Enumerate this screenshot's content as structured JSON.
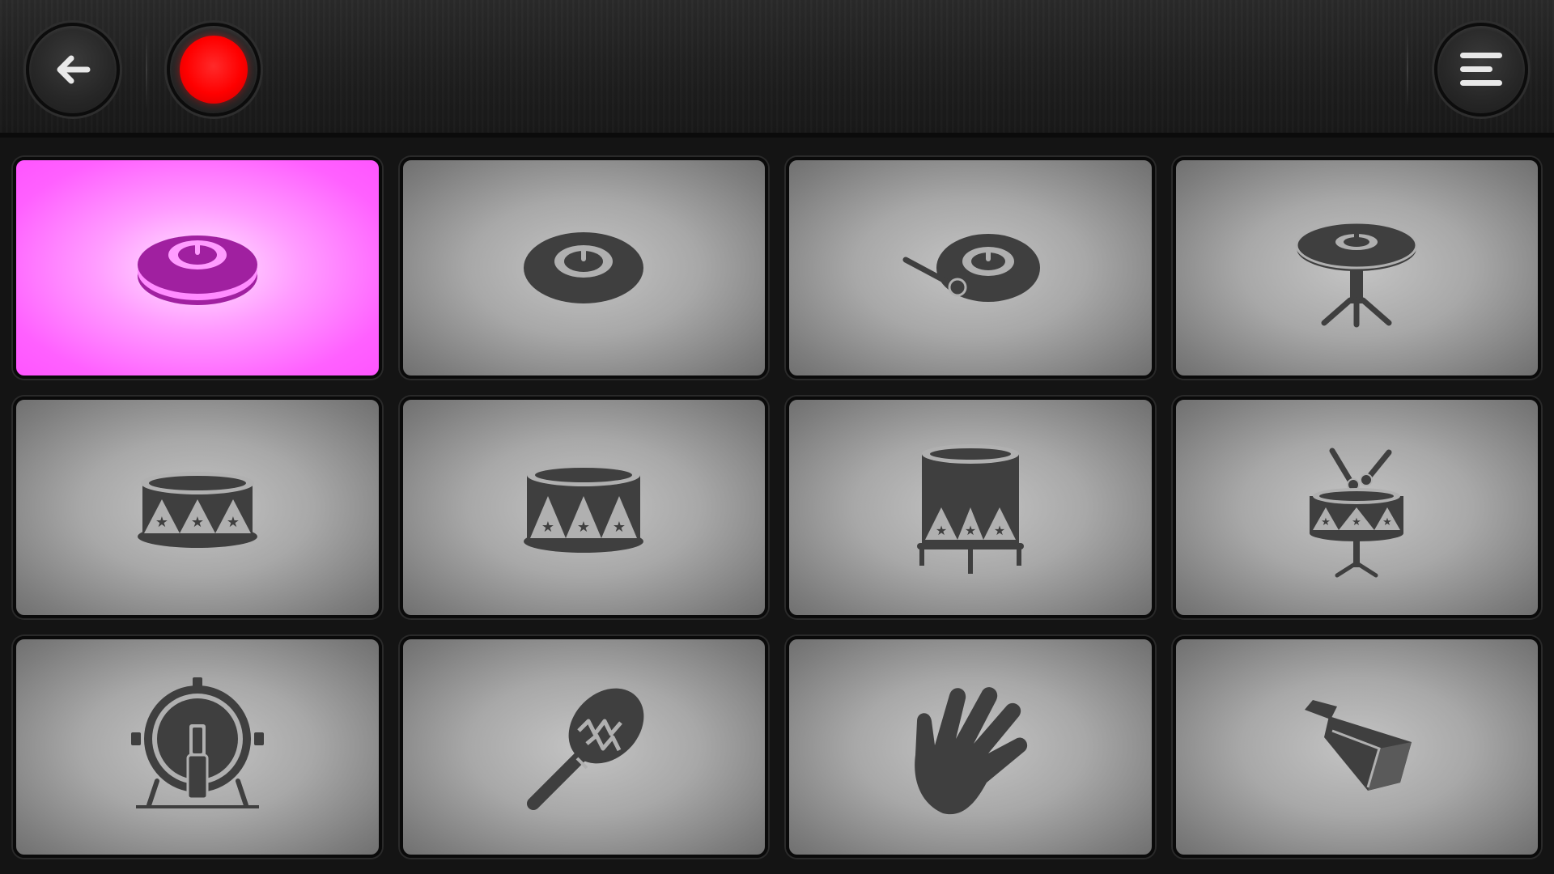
{
  "app": {
    "accent_color": "#ff55ff",
    "record_color": "#ff0000",
    "pad_color": "#a8a8a8",
    "icon_color": "#3f3f3f"
  },
  "topbar": {
    "back_icon": "arrow-left-icon",
    "record_icon": "record-dot-icon",
    "menu_icon": "hamburger-menu-icon"
  },
  "pads": [
    {
      "id": "cymbal-stack",
      "icon": "stacked-cymbal-icon",
      "active": true
    },
    {
      "id": "cymbal",
      "icon": "cymbal-icon",
      "active": false
    },
    {
      "id": "cymbal-stick",
      "icon": "cymbal-with-stick-icon",
      "active": false
    },
    {
      "id": "hihat",
      "icon": "hi-hat-stand-icon",
      "active": false
    },
    {
      "id": "snare-low",
      "icon": "snare-drum-low-icon",
      "active": false
    },
    {
      "id": "tom",
      "icon": "tom-drum-icon",
      "active": false
    },
    {
      "id": "floor-tom",
      "icon": "floor-tom-icon",
      "active": false
    },
    {
      "id": "snare-sticks",
      "icon": "snare-drum-with-sticks-icon",
      "active": false
    },
    {
      "id": "bass-drum",
      "icon": "bass-drum-pedal-icon",
      "active": false
    },
    {
      "id": "maraca",
      "icon": "maraca-icon",
      "active": false
    },
    {
      "id": "clap",
      "icon": "hand-clap-icon",
      "active": false
    },
    {
      "id": "cowbell",
      "icon": "cowbell-icon",
      "active": false
    }
  ]
}
